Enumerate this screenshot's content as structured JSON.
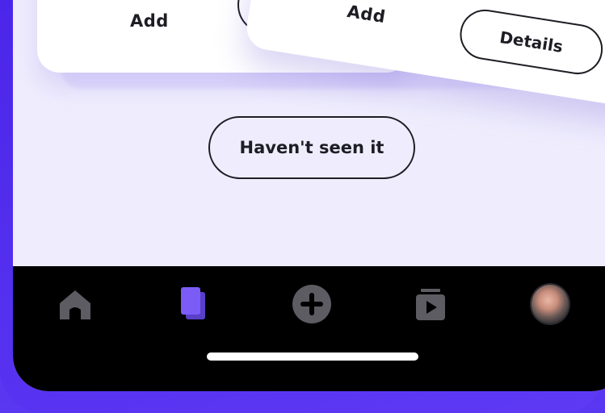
{
  "cards": {
    "back_add_label": "Add",
    "front_add_label": "Add",
    "front_details_label": "Details"
  },
  "actions": {
    "havent_seen_label": "Haven't seen it"
  },
  "tab_bar": {
    "items": [
      {
        "icon": "home-icon",
        "active": false
      },
      {
        "icon": "cards-icon",
        "active": true
      },
      {
        "icon": "add-circle-icon",
        "active": false
      },
      {
        "icon": "watchlist-icon",
        "active": false
      },
      {
        "icon": "avatar",
        "active": false
      }
    ],
    "active_color": "#7b5cf6",
    "inactive_color": "#5c5c62"
  }
}
